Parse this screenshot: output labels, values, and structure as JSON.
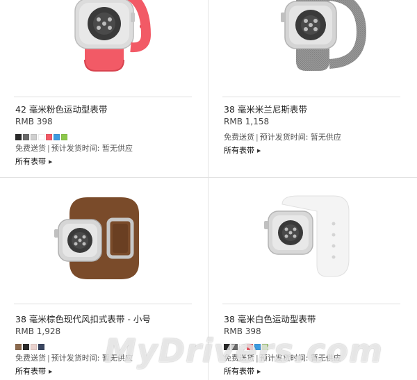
{
  "colors": {
    "accent_pink": "#f25a66",
    "milanese_steel": "#9a9a9a",
    "brown_leather": "#7a4b2a",
    "white_sport": "#f4f4f4",
    "watch_body": "#d8d8d8",
    "divider": "#e2e2e2"
  },
  "products": [
    {
      "name": "42 毫米粉色运动型表带",
      "price": "RMB 398",
      "swatches": [
        "#2a2a2a",
        "#6a6a6a",
        "#cfcfcf",
        "#ffffff",
        "#f25a66",
        "#3d9be0",
        "#8cc84b"
      ],
      "shipping": "免费送货",
      "ship_time": "预计发货时间: 暂无供应",
      "all_bands": "所有表带"
    },
    {
      "name": "38 毫米米兰尼斯表带",
      "price": "RMB 1,158",
      "swatches": [],
      "shipping": "免费送货",
      "ship_time": "预计发货时间: 暂无供应",
      "all_bands": "所有表带"
    },
    {
      "name": "38 毫米棕色现代风扣式表带 - 小号",
      "price": "RMB 1,928",
      "swatches": [
        "#8c6a4e",
        "#2b2b2b",
        "#ead2ce",
        "#3a4660"
      ],
      "shipping": "免费送货",
      "ship_time": "预计发货时间: 暂无供应",
      "all_bands": "所有表带"
    },
    {
      "name": "38 毫米白色运动型表带",
      "price": "RMB 398",
      "swatches": [
        "#2a2a2a",
        "#6a6a6a",
        "#ffffff",
        "#f25a66",
        "#3d9be0",
        "#8cc84b"
      ],
      "shipping": "免费送货",
      "ship_time": "预计发货时间: 暂无供应",
      "all_bands": "所有表带"
    }
  ],
  "separator": "|",
  "watermark": "MyDrivers.com"
}
